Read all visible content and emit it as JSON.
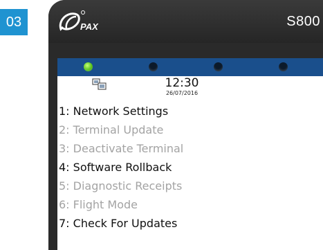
{
  "step": {
    "number": "03"
  },
  "device": {
    "brand": "PAX",
    "model": "S800"
  },
  "status": {
    "leds": [
      {
        "name": "led-1",
        "state": "on",
        "color": "#58c21a"
      },
      {
        "name": "led-2",
        "state": "off"
      },
      {
        "name": "led-3",
        "state": "off"
      },
      {
        "name": "led-4",
        "state": "off"
      }
    ],
    "time": "12:30",
    "date": "26/07/2016",
    "network_icon": "network-icon"
  },
  "menu": {
    "items": [
      {
        "label": "1: Network Settings",
        "enabled": true
      },
      {
        "label": "2: Terminal Update",
        "enabled": false
      },
      {
        "label": "3: Deactivate Terminal",
        "enabled": false
      },
      {
        "label": "4: Software Rollback",
        "enabled": true
      },
      {
        "label": "5: Diagnostic Receipts",
        "enabled": false
      },
      {
        "label": "6: Flight Mode",
        "enabled": false
      },
      {
        "label": "7: Check For Updates",
        "enabled": true
      }
    ]
  },
  "colors": {
    "badge": "#1f93d1",
    "status_bar": "#1a4f8c",
    "enabled_text": "#101010",
    "disabled_text": "#a3a3a3"
  }
}
